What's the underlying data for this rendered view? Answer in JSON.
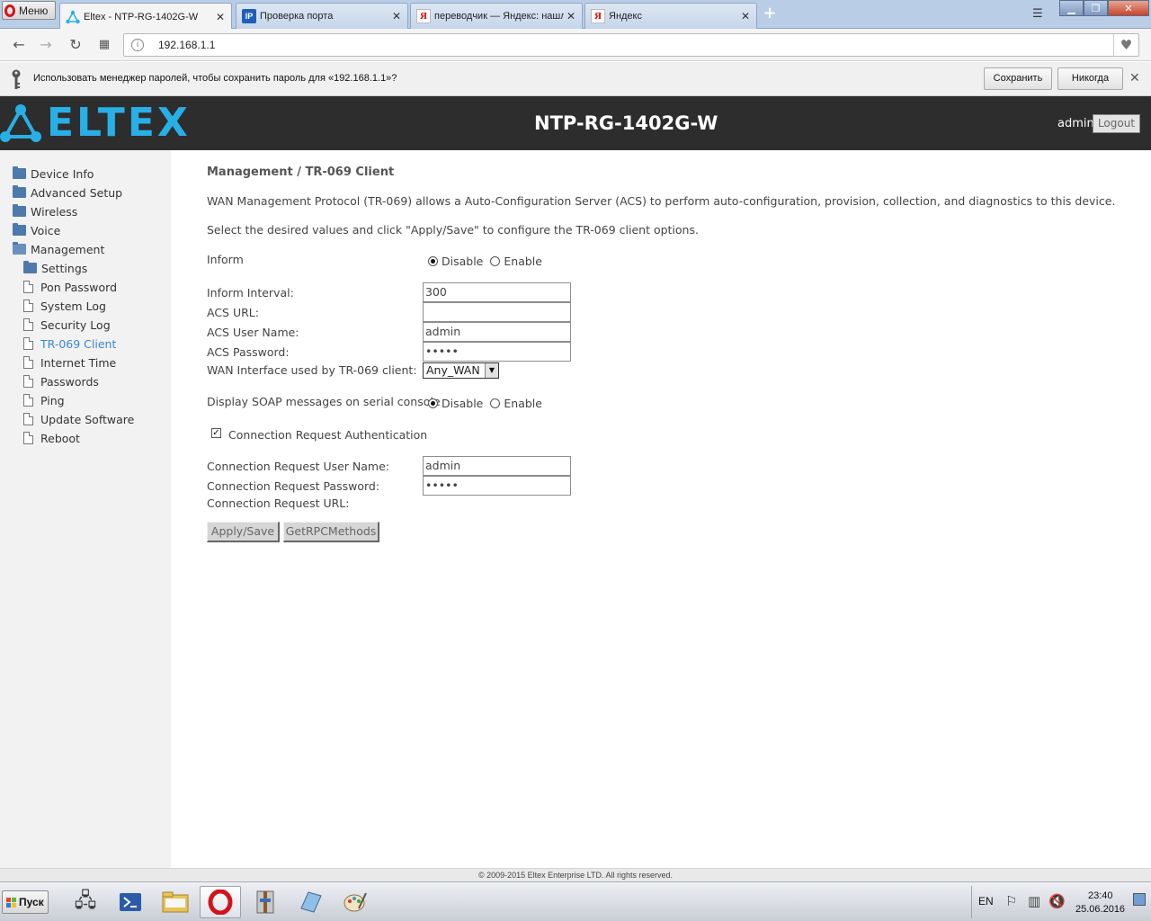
{
  "browser": {
    "menu_label": "Меню",
    "tabs": [
      {
        "title": "Eltex - NTP-RG-1402G-W",
        "icon": "eltex-favicon",
        "active": true
      },
      {
        "title": "Проверка порта",
        "icon": "ip-favicon",
        "active": false
      },
      {
        "title": "переводчик — Яндекс: нашлось",
        "icon": "yandex-favicon",
        "active": false
      },
      {
        "title": "Яндекс",
        "icon": "yandex-favicon",
        "active": false
      }
    ],
    "url": "192.168.1.1"
  },
  "password_bar": {
    "message": "Использовать менеджер паролей, чтобы сохранить пароль для «192.168.1.1»?",
    "save_label": "Сохранить",
    "never_label": "Никогда"
  },
  "header": {
    "logo_text": "ELTEX",
    "device_title": "NTP-RG-1402G-W",
    "user": "admin",
    "logout_label": "Logout"
  },
  "sidebar": {
    "items": [
      {
        "label": "Device Info",
        "type": "folder"
      },
      {
        "label": "Advanced Setup",
        "type": "folder"
      },
      {
        "label": "Wireless",
        "type": "folder"
      },
      {
        "label": "Voice",
        "type": "folder"
      },
      {
        "label": "Management",
        "type": "folder-open"
      },
      {
        "label": "Settings",
        "type": "folder-sub"
      },
      {
        "label": "Pon Password",
        "type": "page"
      },
      {
        "label": "System Log",
        "type": "page"
      },
      {
        "label": "Security Log",
        "type": "page"
      },
      {
        "label": "TR-069 Client",
        "type": "page",
        "active": true
      },
      {
        "label": "Internet Time",
        "type": "page"
      },
      {
        "label": "Passwords",
        "type": "page"
      },
      {
        "label": "Ping",
        "type": "page"
      },
      {
        "label": "Update Software",
        "type": "page"
      },
      {
        "label": "Reboot",
        "type": "page"
      }
    ]
  },
  "main": {
    "heading": "Management / TR-069 Client",
    "description1": "WAN Management Protocol (TR-069) allows a Auto-Configuration Server (ACS) to perform auto-configuration, provision, collection, and diagnostics to this device.",
    "description2": "Select the desired values and click \"Apply/Save\" to configure the TR-069 client options.",
    "inform_label": "Inform",
    "disable_label": "Disable",
    "enable_label": "Enable",
    "inform_value": "Disable",
    "inform_interval_label": "Inform Interval:",
    "inform_interval_value": "300",
    "acs_url_label": "ACS URL:",
    "acs_url_value": "",
    "acs_user_label": "ACS User Name:",
    "acs_user_value": "admin",
    "acs_password_label": "ACS Password:",
    "acs_password_value": "•••••",
    "wan_interface_label": "WAN Interface used by TR-069 client:",
    "wan_interface_value": "Any_WAN",
    "soap_label": "Display SOAP messages on serial console",
    "soap_value": "Disable",
    "conn_auth_label": "Connection Request Authentication",
    "conn_auth_checked": true,
    "conn_user_label": "Connection Request User Name:",
    "conn_user_value": "admin",
    "conn_password_label": "Connection Request Password:",
    "conn_password_value": "•••••",
    "conn_url_label": "Connection Request URL:",
    "apply_label": "Apply/Save",
    "rpc_label": "GetRPCMethods"
  },
  "footer": {
    "copyright": "© 2009-2015 Eltex Enterprise LTD. All rights reserved."
  },
  "taskbar": {
    "start_label": "Пуск",
    "language": "EN",
    "time": "23:40",
    "date": "25.06.2016"
  },
  "colors": {
    "brand_blue": "#28b0e6",
    "header_bg": "#2d2d2d",
    "sidebar_bg": "#f2f2f2",
    "active_link": "#3a86d0"
  }
}
